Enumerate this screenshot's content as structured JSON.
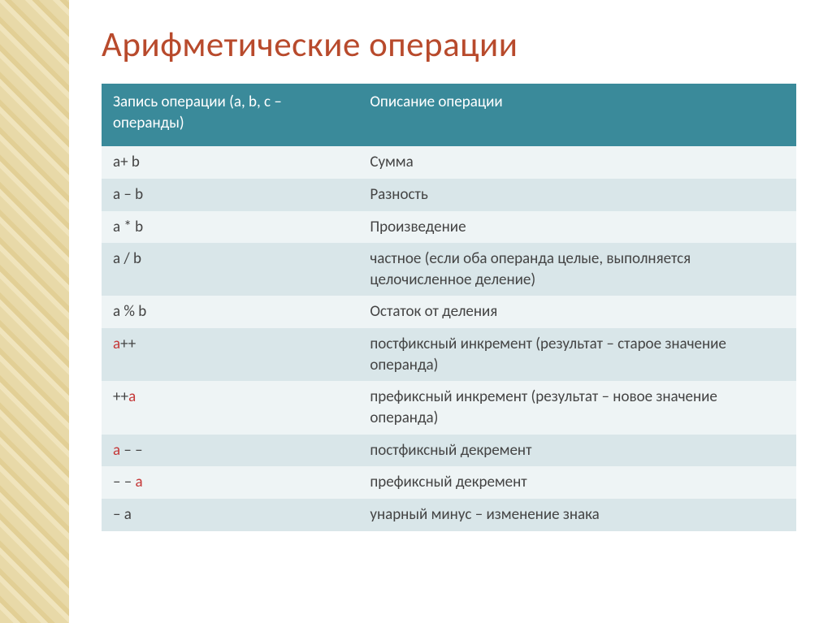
{
  "title": "Арифметические операции",
  "table": {
    "headers": {
      "col1": "Запись операции (a, b, c – операнды)",
      "col2": "Описание операции"
    },
    "rows": [
      {
        "op_pre": "a+ b",
        "a_red": "",
        "op_post": "",
        "desc": "Сумма"
      },
      {
        "op_pre": "a – b",
        "a_red": "",
        "op_post": "",
        "desc": "Разность"
      },
      {
        "op_pre": "a * b",
        "a_red": "",
        "op_post": "",
        "desc": "Произведение"
      },
      {
        "op_pre": "a / b",
        "a_red": "",
        "op_post": "",
        "desc": "частное (если оба операнда целые, выполняется целочисленное деление)"
      },
      {
        "op_pre": "a % b",
        "a_red": "",
        "op_post": "",
        "desc": "Остаток от деления"
      },
      {
        "op_pre": "",
        "a_red": "a",
        "op_post": "++",
        "desc": "постфиксный инкремент (результат – старое значение операнда)"
      },
      {
        "op_pre": "++",
        "a_red": "a",
        "op_post": "",
        "desc": "префиксный инкремент (результат – новое значение операнда)"
      },
      {
        "op_pre": "",
        "a_red": "a",
        "op_post": " – –",
        "desc": "постфиксный декремент"
      },
      {
        "op_pre": "– – ",
        "a_red": "a",
        "op_post": "",
        "desc": "префиксный декремент"
      },
      {
        "op_pre": "– a",
        "a_red": "",
        "op_post": "",
        "desc": "унарный минус – изменение знака"
      }
    ]
  }
}
